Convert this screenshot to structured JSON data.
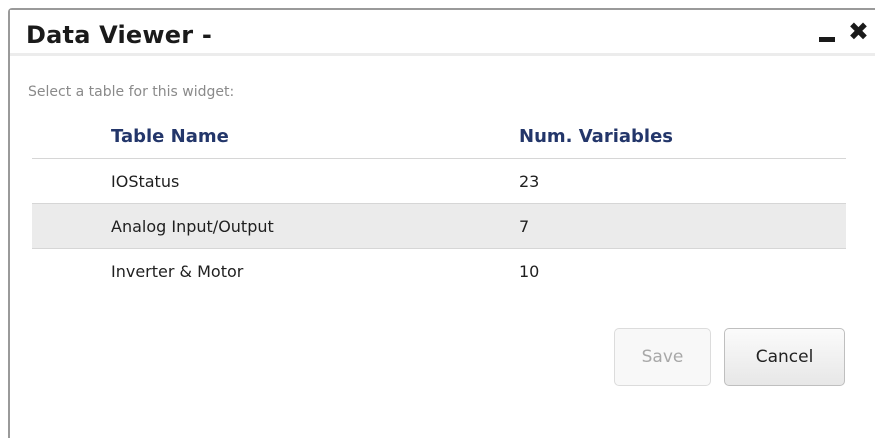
{
  "window": {
    "title": "Data Viewer -",
    "minimize_label": "—",
    "close_label": "✖"
  },
  "dialog": {
    "prompt": "Select a table for this widget:"
  },
  "table": {
    "headers": {
      "name": "Table Name",
      "num_variables": "Num. Variables"
    },
    "rows": [
      {
        "name": "IOStatus",
        "num_variables": "23"
      },
      {
        "name": "Analog Input/Output",
        "num_variables": "7"
      },
      {
        "name": "Inverter & Motor",
        "num_variables": "10"
      }
    ]
  },
  "buttons": {
    "save": {
      "label": "Save",
      "state": "disabled"
    },
    "cancel": {
      "label": "Cancel"
    }
  },
  "colors": {
    "header_text": "#23366a",
    "row_alt_background": "#ebebeb",
    "disabled_text": "#a8a8a8"
  }
}
